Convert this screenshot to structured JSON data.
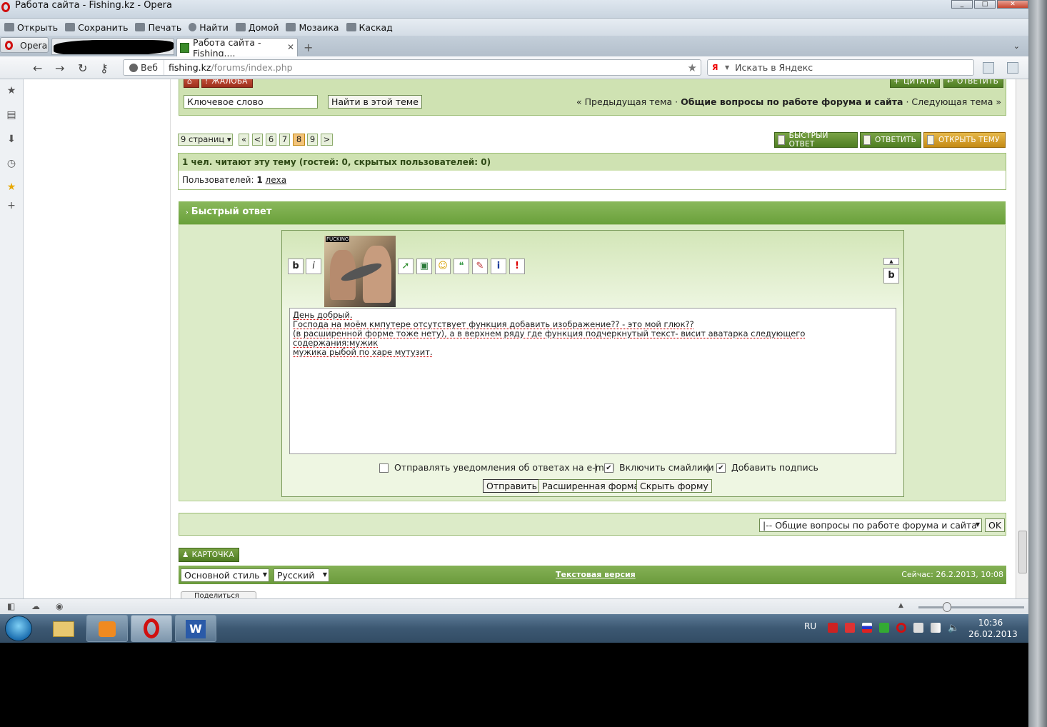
{
  "window": {
    "title": "Работа сайта - Fishing.kz - Opera"
  },
  "menubar": [
    {
      "label": "Открыть",
      "icon": "folder-icon"
    },
    {
      "label": "Сохранить",
      "icon": "save-icon"
    },
    {
      "label": "Печать",
      "icon": "print-icon"
    },
    {
      "label": "Найти",
      "icon": "search-icon"
    },
    {
      "label": "Домой",
      "icon": "home-icon"
    },
    {
      "label": "Мозаика",
      "icon": "tile-icon"
    },
    {
      "label": "Каскад",
      "icon": "cascade-icon"
    }
  ],
  "tabs": {
    "opera_label": "Opera",
    "active_title": "Работа сайта - Fishing...."
  },
  "address": {
    "web_label": "Веб",
    "url_host": "fishing.kz",
    "url_path": "/forums/index.php",
    "search_placeholder": "Искать в Яндекс"
  },
  "topic_bar": {
    "report_label": "ЖАЛОБА",
    "quote_label": "ЦИТАТА",
    "reply_label": "ОТВЕТИТЬ",
    "keyword_value": "Ключевое слово",
    "find_button": "Найти в этой теме",
    "prev_topic": "« Предыдущая тема",
    "sep1": "·",
    "forum_name": "Общие вопросы по работе форума и сайта",
    "sep2": "·",
    "next_topic": "Следующая тема »"
  },
  "pagination": {
    "pages_label": "9 страниц",
    "first": "«",
    "prev": "<",
    "pages": [
      "6",
      "7",
      "8",
      "9"
    ],
    "current": "8",
    "next": ">"
  },
  "action_buttons": {
    "quick_reply": "БЫСТРЫЙ ОТВЕТ",
    "reply": "ОТВЕТИТЬ",
    "new_topic": "ОТКРЫТЬ ТЕМУ"
  },
  "readers": {
    "summary": "1 чел. читают эту тему (гостей: 0, скрытых пользователей: 0)",
    "users_label": "Пользователей:",
    "users_count": "1",
    "user_name": "леха"
  },
  "quick_reply": {
    "header": "Быстрый ответ",
    "avatar_text": "FUCKING",
    "toolbar": {
      "bold": "b",
      "italic": "i",
      "right_bold": "b",
      "collapse": "▲"
    },
    "message_lines": [
      "День добрый.",
      "Господа на моём кмпутере отсутствует функция добавить изображение?? - это мой глюк??",
      "(в расширенной форме тоже нету), а в верхнем ряду где функция подчеркнутый текст- висит аватарка следующего содержания:мужик",
      "мужика рыбой по харе мутузит."
    ],
    "options": [
      {
        "label": "Отправлять уведомления об ответах на e-mail",
        "checked": false
      },
      {
        "label": "Включить смайлики",
        "checked": true
      },
      {
        "label": "Добавить подпись",
        "checked": true
      }
    ],
    "option_sep": "|",
    "submit": "Отправить",
    "advanced": "Расширенная форма",
    "hide": "Скрыть форму"
  },
  "jump": {
    "selected": "|-- Общие вопросы по работе форума и сайта",
    "ok": "OK"
  },
  "card_button": "КАРТОЧКА",
  "footer": {
    "style": "Основной стиль",
    "language": "Русский",
    "text_version": "Текстовая версия",
    "now": "Сейчас: 26.2.2013, 10:08"
  },
  "share_label": "Поделиться",
  "taskbar": {
    "lang": "RU",
    "time": "10:36",
    "date": "26.02.2013"
  }
}
